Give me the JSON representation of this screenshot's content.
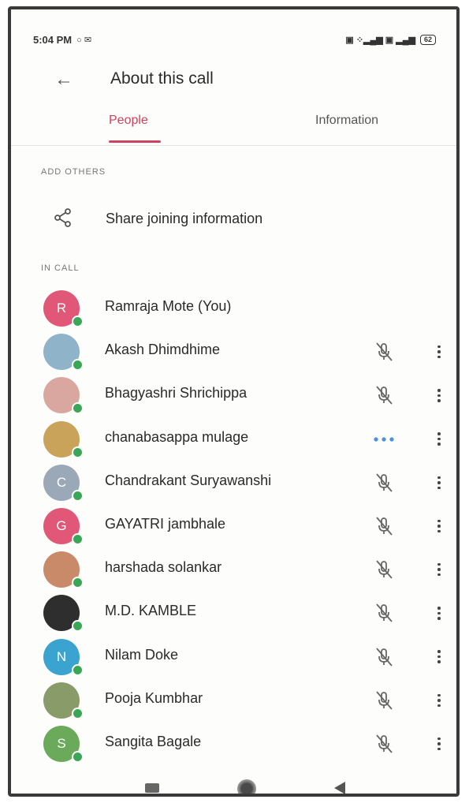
{
  "status_bar": {
    "time": "5:04 PM",
    "left_icons": "○ ✉",
    "right_icons": "▣ ⁘▂▄▆ ▣ ▂▄▆",
    "battery": "62"
  },
  "app_bar": {
    "title": "About this call"
  },
  "tabs": [
    {
      "label": "People"
    },
    {
      "label": "Information"
    }
  ],
  "add_others": {
    "header": "ADD OTHERS",
    "share_label": "Share joining information"
  },
  "in_call": {
    "header": "IN CALL",
    "participants": [
      {
        "name": "Ramraja Mote (You)",
        "initial": "R",
        "avatar_color": "#e05777"
      },
      {
        "name": "Akash Dhimdhime",
        "initial": "",
        "avatar_color": "#8fb3c9"
      },
      {
        "name": "Bhagyashri Shrichippa",
        "initial": "",
        "avatar_color": "#d9a7a0"
      },
      {
        "name": "chanabasappa mulage",
        "initial": "",
        "avatar_color": "#c9a35a"
      },
      {
        "name": "Chandrakant Suryawanshi",
        "initial": "C",
        "avatar_color": "#9aa8b8"
      },
      {
        "name": "GAYATRI jambhale",
        "initial": "G",
        "avatar_color": "#e05777"
      },
      {
        "name": "harshada solankar",
        "initial": "",
        "avatar_color": "#c98a6a"
      },
      {
        "name": "M.D. KAMBLE",
        "initial": "",
        "avatar_color": "#2e2e2e"
      },
      {
        "name": "Nilam Doke",
        "initial": "N",
        "avatar_color": "#3aa3d0"
      },
      {
        "name": "Pooja Kumbhar",
        "initial": "",
        "avatar_color": "#8a9b6a"
      },
      {
        "name": "Sangita Bagale",
        "initial": "S",
        "avatar_color": "#6aaa5a"
      }
    ]
  },
  "colors": {
    "accent": "#d2415e",
    "online": "#3aa757",
    "speaking": "#4a8fe0"
  }
}
